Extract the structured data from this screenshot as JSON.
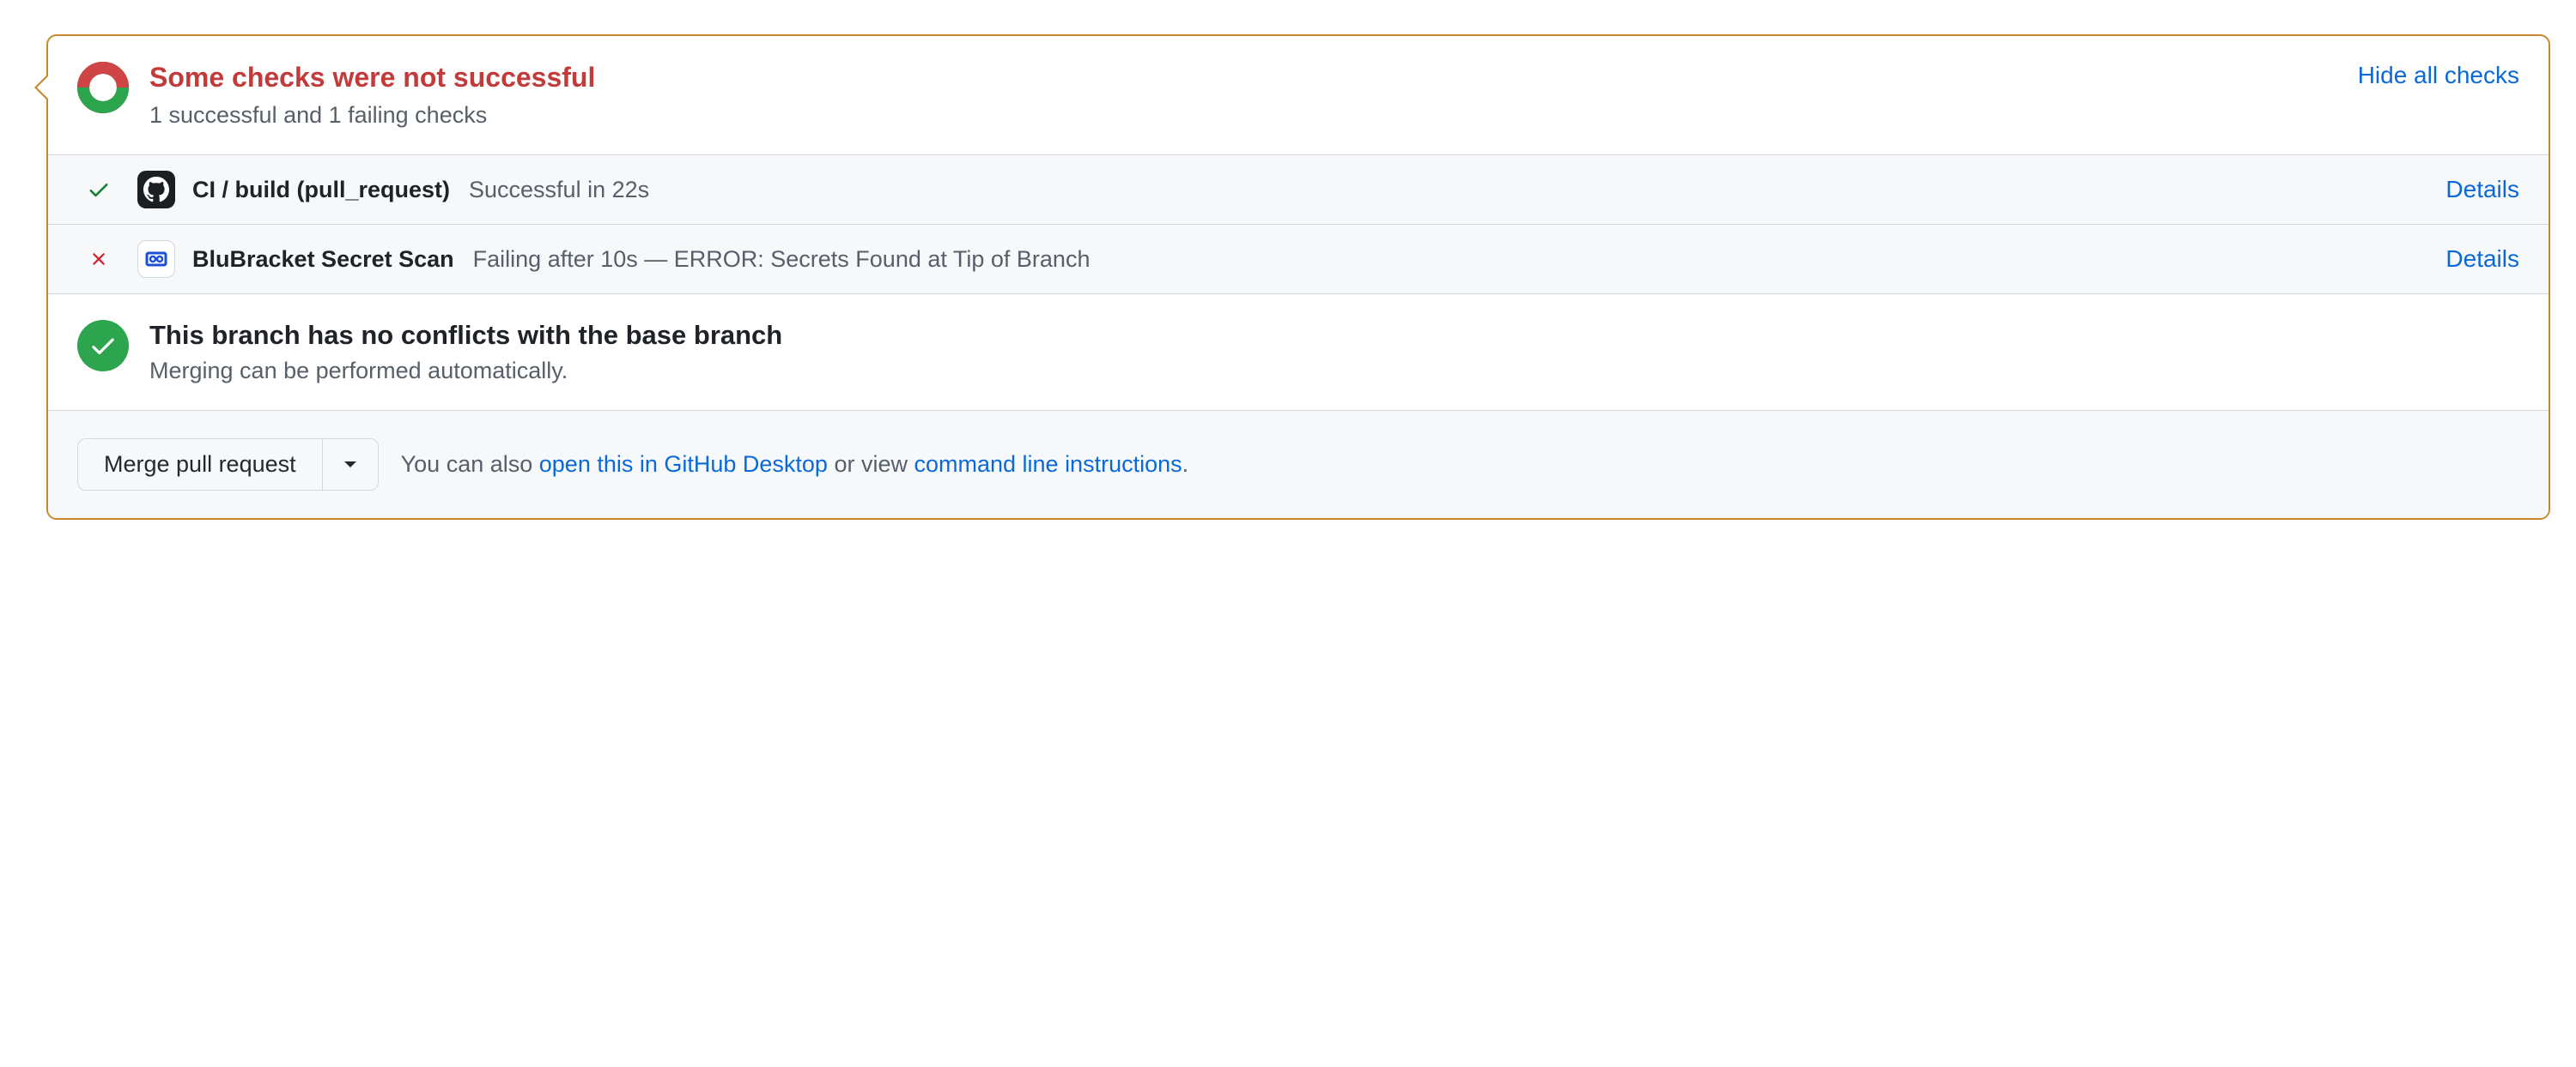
{
  "header": {
    "title": "Some checks were not successful",
    "subtitle": "1 successful and 1 failing checks",
    "toggle_link": "Hide all checks"
  },
  "checks": [
    {
      "status": "success",
      "avatar": "github",
      "name": "CI / build (pull_request)",
      "message": "Successful in 22s",
      "details_label": "Details"
    },
    {
      "status": "failure",
      "avatar": "blubracket",
      "name": "BluBracket Secret Scan",
      "message": "Failing after 10s — ERROR: Secrets Found at Tip of Branch",
      "details_label": "Details"
    }
  ],
  "conflicts": {
    "title": "This branch has no conflicts with the base branch",
    "subtitle": "Merging can be performed automatically."
  },
  "actions": {
    "merge_button": "Merge pull request",
    "alt_prefix": "You can also ",
    "desktop_link": "open this in GitHub Desktop",
    "alt_middle": " or view ",
    "cli_link": "command line instructions",
    "alt_suffix": "."
  }
}
